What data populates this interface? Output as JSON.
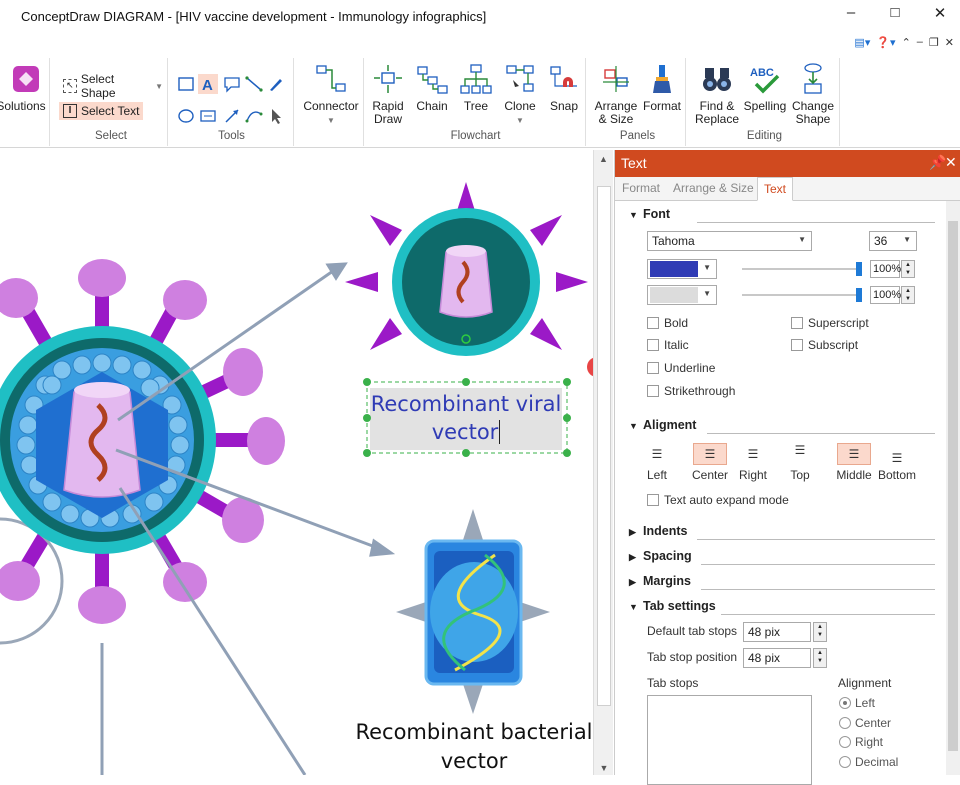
{
  "window": {
    "title": "ConceptDraw DIAGRAM - [HIV vaccine development - Immunology infographics]"
  },
  "ribbon": {
    "solutions": "Solutions",
    "select_shape": "Select Shape",
    "select_text": "Select Text",
    "select_group": "Select",
    "tools_group": "Tools",
    "connector": "Connector",
    "rapid_draw": "Rapid Draw",
    "chain": "Chain",
    "tree": "Tree",
    "clone": "Clone",
    "snap": "Snap",
    "flowchart_group": "Flowchart",
    "arrange_size": "Arrange & Size",
    "format": "Format",
    "panels_group": "Panels",
    "find_replace": "Find & Replace",
    "spelling": "Spelling",
    "change_shape": "Change Shape",
    "editing_group": "Editing"
  },
  "canvas": {
    "label_viral": "Recombinant viral vector",
    "label_viral_l1": "Recombinant viral",
    "label_viral_l2": "vector",
    "label_bacterial_l1": "Recombinant bacterial",
    "label_bacterial_l2": "vector"
  },
  "panel": {
    "title": "Text",
    "tabs": [
      "Format",
      "Arrange & Size",
      "Text"
    ],
    "font_section": "Font",
    "font_name": "Tahoma",
    "font_size": "36",
    "text_color": "#2f3bb5",
    "fill_color": "#dcdcdc",
    "opacity1": "100%",
    "opacity2": "100%",
    "bold": "Bold",
    "italic": "Italic",
    "underline": "Underline",
    "strikethrough": "Strikethrough",
    "superscript": "Superscript",
    "subscript": "Subscript",
    "alignment_section": "Aligment",
    "align_left": "Left",
    "align_center": "Center",
    "align_right": "Right",
    "align_top": "Top",
    "align_middle": "Middle",
    "align_bottom": "Bottom",
    "auto_expand": "Text auto expand mode",
    "indents_section": "Indents",
    "spacing_section": "Spacing",
    "margins_section": "Margins",
    "tab_settings_section": "Tab settings",
    "default_tab_stops_label": "Default tab stops",
    "default_tab_stops_value": "48 pix",
    "tab_stop_position_label": "Tab stop position",
    "tab_stop_position_value": "48 pix",
    "tab_stops_label": "Tab stops",
    "alignment_label": "Alignment",
    "radio_left": "Left",
    "radio_center": "Center",
    "radio_right": "Right",
    "radio_decimal": "Decimal"
  }
}
